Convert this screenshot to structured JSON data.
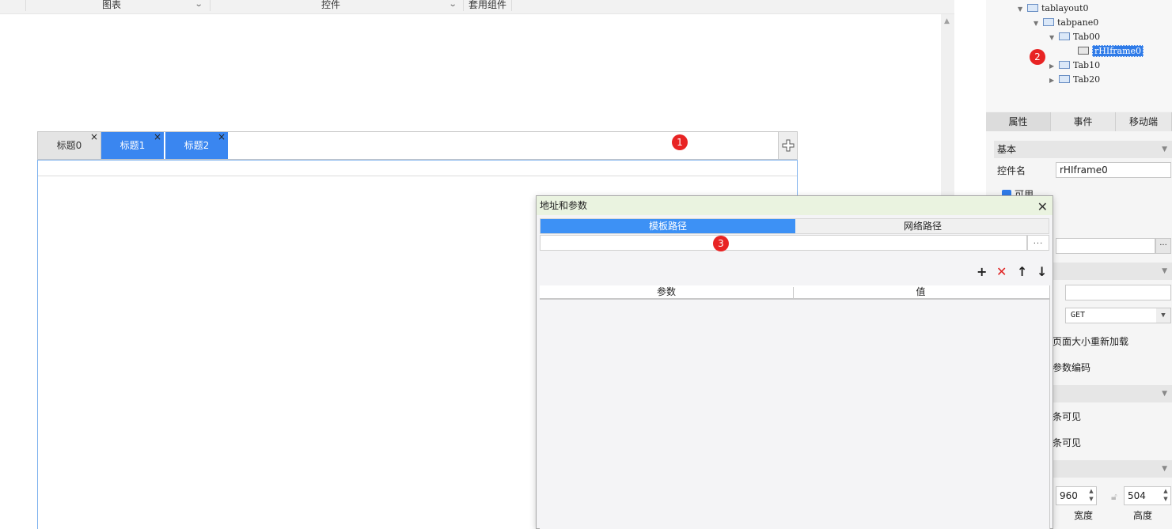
{
  "toolbar": {
    "chart_label": "图表",
    "widget_label": "控件",
    "template_label": "套用组件"
  },
  "tab_layout": {
    "tabs": [
      {
        "label": "标题0",
        "active": false
      },
      {
        "label": "标题1",
        "active": true
      },
      {
        "label": "标题2",
        "active": true
      }
    ],
    "close_glyph": "×",
    "add_icon": "plus-icon"
  },
  "badges": {
    "one": "1",
    "two": "2",
    "three": "3"
  },
  "tree": {
    "nodes": [
      {
        "label": "tablayout0"
      },
      {
        "label": "tabpane0"
      },
      {
        "label": "Tab00"
      },
      {
        "label": "rHIframe0"
      },
      {
        "label": "Tab10"
      },
      {
        "label": "Tab20"
      }
    ]
  },
  "properties": {
    "tabs": [
      "属性",
      "事件",
      "移动端"
    ],
    "section_basic": "基本",
    "widget_name_label": "控件名",
    "widget_name_value": "rHIframe0",
    "enabled_label": "可用",
    "method_value": "GET",
    "reload_label": "页面大小重新加载",
    "encode_label": "参数编码",
    "scroll_x_label": "条可见",
    "scroll_y_label": "条可见",
    "width_value": "960",
    "width_label": "宽度",
    "height_value": "504",
    "height_label": "高度"
  },
  "dialog": {
    "title": "地址和参数",
    "close_glyph": "✕",
    "tab_template": "模板路径",
    "tab_network": "网络路径",
    "browse_label": "...",
    "col_param": "参数",
    "col_value": "值",
    "add_glyph": "+",
    "delete_glyph": "✕",
    "up_glyph": "↑",
    "down_glyph": "↓"
  },
  "colors": {
    "accent": "#3a86f0",
    "badge": "#e82424",
    "dialog_title_bg": "#eaf3e0"
  }
}
